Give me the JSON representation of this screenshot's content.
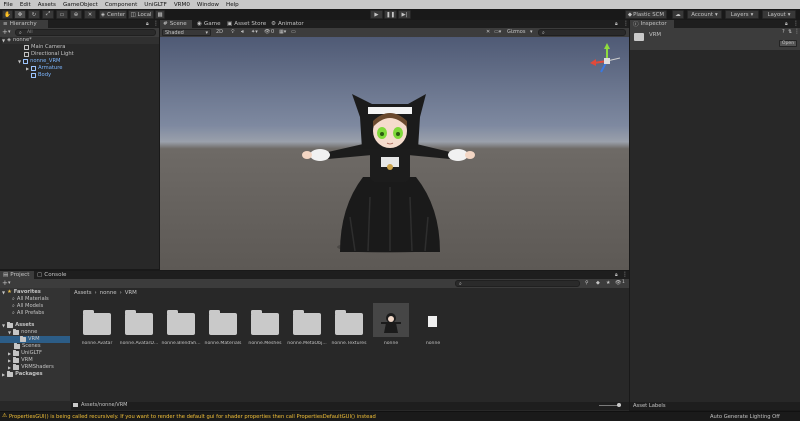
{
  "menu": [
    "File",
    "Edit",
    "Assets",
    "GameObject",
    "Component",
    "UniGLTF",
    "VRM0",
    "Window",
    "Help"
  ],
  "toolbar": {
    "pivot": "Center",
    "space": "Local",
    "plastic": "Plastic SCM",
    "account": "Account",
    "layers": "Layers",
    "layout": "Layout"
  },
  "hierarchy": {
    "tab": "Hierarchy",
    "search_placeholder": "All",
    "scene": "nonne*",
    "items": [
      "Main Camera",
      "Directional Light",
      "nonne_VRM",
      "Armature",
      "Body"
    ]
  },
  "scene_view": {
    "tabs": [
      "Scene",
      "Game",
      "Asset Store",
      "Animator"
    ],
    "shading": "Shaded",
    "mode2d": "2D",
    "gizmos": "Gizmos",
    "gizmo_count": "0"
  },
  "inspector": {
    "tab": "Inspector",
    "title": "VRM",
    "open_button": "Open",
    "asset_labels": "Asset Labels"
  },
  "project": {
    "tabs": [
      "Project",
      "Console"
    ],
    "favorites_label": "Favorites",
    "favorites": [
      "All Materials",
      "All Models",
      "All Prefabs"
    ],
    "assets_label": "Assets",
    "tree": [
      "nonne",
      "VRM",
      "Scenes",
      "UniGLTF",
      "VRM",
      "VRMShaders"
    ],
    "packages_label": "Packages",
    "breadcrumb": [
      "Assets",
      "nonne",
      "VRM"
    ],
    "items": [
      "nonne.Avatar",
      "nonne.AvatarD...",
      "nonne.BlendSh...",
      "nonne.Materials",
      "nonne.Meshes",
      "nonne.MetaObj...",
      "nonne.Textures",
      "nonne",
      "nonne"
    ],
    "path": "Assets/nonne/VRM",
    "layer_count": "1"
  },
  "status": {
    "warning": "PropertiesGUI() is being called recursively. If you want to render the default gui for shader properties then call PropertiesDefaultGUI() instead",
    "lighting": "Auto Generate Lighting Off"
  }
}
